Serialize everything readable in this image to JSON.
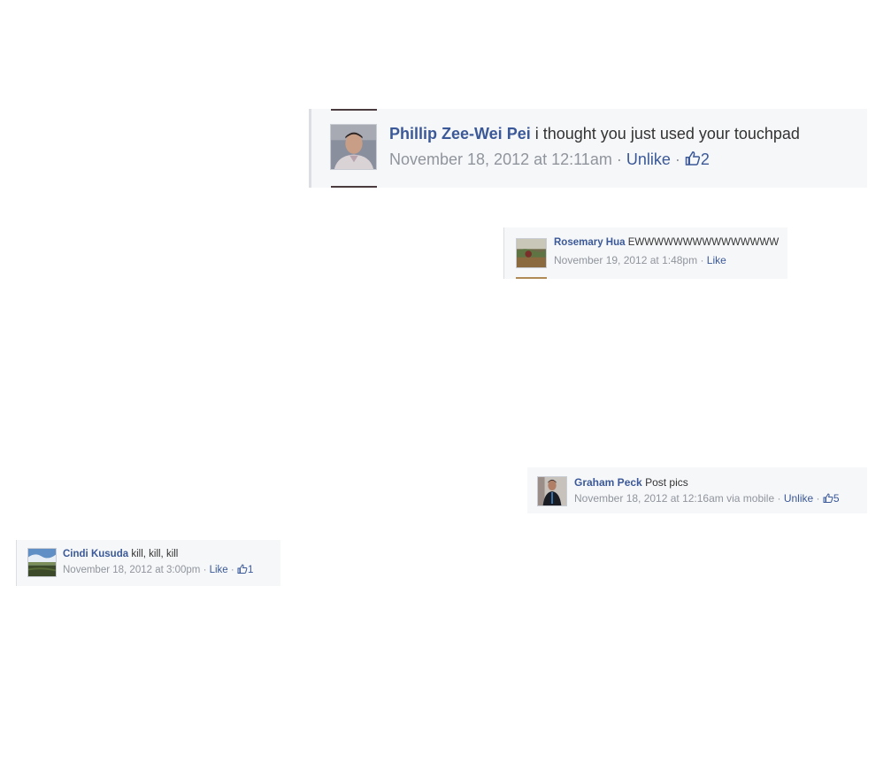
{
  "comments": [
    {
      "author": "Phillip Zee-Wei Pei",
      "text": "i thought you just used your touchpad",
      "timestamp": "November 18, 2012 at 12:11am",
      "separator": "·",
      "action": "Unlike",
      "like_count": "2",
      "avatar_icon": "profile-photo-man"
    },
    {
      "author": "Rosemary Hua",
      "text": "EWWWWWWWWWWWWWWW",
      "timestamp": "November 19, 2012 at 1:48pm",
      "separator": "·",
      "action": "Like",
      "avatar_icon": "profile-photo-landscape"
    },
    {
      "author": "Graham Peck",
      "text": "Post pics",
      "timestamp": "November 18, 2012 at 12:16am via mobile",
      "separator": "·",
      "action": "Unlike",
      "like_count": "5",
      "avatar_icon": "profile-photo-man-dark"
    },
    {
      "author": "Cindi Kusuda",
      "text": "kill, kill, kill",
      "timestamp": "November 18, 2012 at 3:00pm",
      "separator": "·",
      "action": "Like",
      "like_count": "1",
      "avatar_icon": "profile-photo-field"
    }
  ],
  "colors": {
    "link": "#3b5998",
    "meta": "#90949c",
    "comment_bg": "#f6f7f9"
  }
}
